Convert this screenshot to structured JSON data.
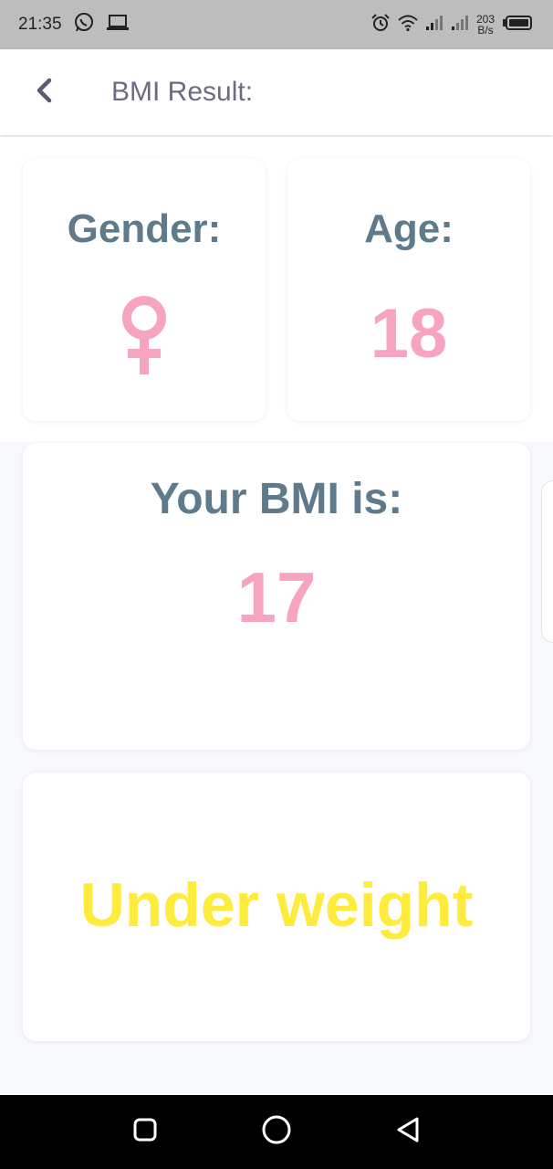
{
  "status_bar": {
    "time": "21:35",
    "net_speed_value": "203",
    "net_speed_unit": "B/s"
  },
  "app_bar": {
    "title": "BMI Result:"
  },
  "gender_card": {
    "label": "Gender:",
    "icon": "female-symbol-icon",
    "icon_color": "#f7a5bf"
  },
  "age_card": {
    "label": "Age:",
    "value": "18"
  },
  "bmi_card": {
    "label": "Your BMI is:",
    "value": "17"
  },
  "category_card": {
    "text": "Under weight",
    "color": "#ffeb3b"
  },
  "colors": {
    "title_text": "#5f7a8b",
    "accent_pink": "#f7a5bf",
    "category_yellow": "#ffeb3b"
  }
}
